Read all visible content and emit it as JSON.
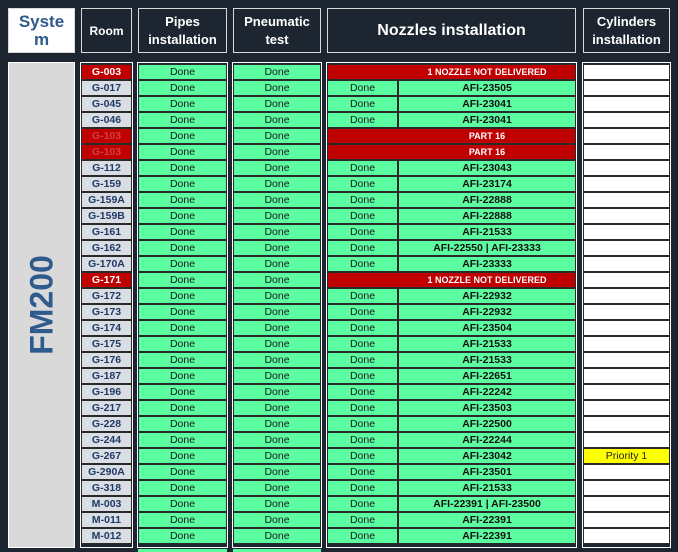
{
  "headers": {
    "system": [
      "Syste",
      "m"
    ],
    "room": "Room",
    "pipes": [
      "Pipes",
      "installation"
    ],
    "pneumatic": [
      "Pneumatic",
      "test"
    ],
    "nozzles": "Nozzles installation",
    "cylinders": [
      "Cylinders",
      "installation"
    ]
  },
  "system_label": "FM200",
  "rows": [
    {
      "room": "G-003",
      "room_status": "red",
      "pipes": "Done",
      "pneumatic": "Done",
      "nozzle_done": "",
      "nozzle": "1 NOZZLE NOT DELIVERED",
      "nozzle_status": "red",
      "cylinder": ""
    },
    {
      "room": "G-017",
      "room_status": "normal",
      "pipes": "Done",
      "pneumatic": "Done",
      "nozzle_done": "Done",
      "nozzle": "AFI-23505",
      "nozzle_status": "ok",
      "cylinder": ""
    },
    {
      "room": "G-045",
      "room_status": "normal",
      "pipes": "Done",
      "pneumatic": "Done",
      "nozzle_done": "Done",
      "nozzle": "AFI-23041",
      "nozzle_status": "ok",
      "cylinder": ""
    },
    {
      "room": "G-046",
      "room_status": "normal",
      "pipes": "Done",
      "pneumatic": "Done",
      "nozzle_done": "Done",
      "nozzle": "AFI-23041",
      "nozzle_status": "ok",
      "cylinder": ""
    },
    {
      "room": "G-103",
      "room_status": "red-dim",
      "pipes": "Done",
      "pneumatic": "Done",
      "nozzle_done": "",
      "nozzle": "PART 16",
      "nozzle_status": "red",
      "cylinder": ""
    },
    {
      "room": "G-103",
      "room_status": "red-dim",
      "pipes": "Done",
      "pneumatic": "Done",
      "nozzle_done": "",
      "nozzle": "PART 16",
      "nozzle_status": "red",
      "cylinder": ""
    },
    {
      "room": "G-112",
      "room_status": "normal",
      "pipes": "Done",
      "pneumatic": "Done",
      "nozzle_done": "Done",
      "nozzle": "AFI-23043",
      "nozzle_status": "ok",
      "cylinder": ""
    },
    {
      "room": "G-159",
      "room_status": "normal",
      "pipes": "Done",
      "pneumatic": "Done",
      "nozzle_done": "Done",
      "nozzle": "AFI-23174",
      "nozzle_status": "ok",
      "cylinder": ""
    },
    {
      "room": "G-159A",
      "room_status": "normal",
      "pipes": "Done",
      "pneumatic": "Done",
      "nozzle_done": "Done",
      "nozzle": "AFI-22888",
      "nozzle_status": "ok",
      "cylinder": ""
    },
    {
      "room": "G-159B",
      "room_status": "normal",
      "pipes": "Done",
      "pneumatic": "Done",
      "nozzle_done": "Done",
      "nozzle": "AFI-22888",
      "nozzle_status": "ok",
      "cylinder": ""
    },
    {
      "room": "G-161",
      "room_status": "normal",
      "pipes": "Done",
      "pneumatic": "Done",
      "nozzle_done": "Done",
      "nozzle": "AFI-21533",
      "nozzle_status": "ok",
      "cylinder": ""
    },
    {
      "room": "G-162",
      "room_status": "normal",
      "pipes": "Done",
      "pneumatic": "Done",
      "nozzle_done": "Done",
      "nozzle": "AFI-22550  |  AFI-23333",
      "nozzle_status": "ok",
      "cylinder": ""
    },
    {
      "room": "G-170A",
      "room_status": "normal",
      "pipes": "Done",
      "pneumatic": "Done",
      "nozzle_done": "Done",
      "nozzle": "AFI-23333",
      "nozzle_status": "ok",
      "cylinder": ""
    },
    {
      "room": "G-171",
      "room_status": "red",
      "pipes": "Done",
      "pneumatic": "Done",
      "nozzle_done": "",
      "nozzle": "1 NOZZLE NOT DELIVERED",
      "nozzle_status": "red",
      "cylinder": ""
    },
    {
      "room": "G-172",
      "room_status": "normal",
      "pipes": "Done",
      "pneumatic": "Done",
      "nozzle_done": "Done",
      "nozzle": "AFI-22932",
      "nozzle_status": "ok",
      "cylinder": ""
    },
    {
      "room": "G-173",
      "room_status": "normal",
      "pipes": "Done",
      "pneumatic": "Done",
      "nozzle_done": "Done",
      "nozzle": "AFI-22932",
      "nozzle_status": "ok",
      "cylinder": ""
    },
    {
      "room": "G-174",
      "room_status": "normal",
      "pipes": "Done",
      "pneumatic": "Done",
      "nozzle_done": "Done",
      "nozzle": "AFI-23504",
      "nozzle_status": "ok",
      "cylinder": ""
    },
    {
      "room": "G-175",
      "room_status": "normal",
      "pipes": "Done",
      "pneumatic": "Done",
      "nozzle_done": "Done",
      "nozzle": "AFI-21533",
      "nozzle_status": "ok",
      "cylinder": ""
    },
    {
      "room": "G-176",
      "room_status": "normal",
      "pipes": "Done",
      "pneumatic": "Done",
      "nozzle_done": "Done",
      "nozzle": "AFI-21533",
      "nozzle_status": "ok",
      "cylinder": ""
    },
    {
      "room": "G-187",
      "room_status": "normal",
      "pipes": "Done",
      "pneumatic": "Done",
      "nozzle_done": "Done",
      "nozzle": "AFI-22651",
      "nozzle_status": "ok",
      "cylinder": ""
    },
    {
      "room": "G-196",
      "room_status": "normal",
      "pipes": "Done",
      "pneumatic": "Done",
      "nozzle_done": "Done",
      "nozzle": "AFI-22242",
      "nozzle_status": "ok",
      "cylinder": ""
    },
    {
      "room": "G-217",
      "room_status": "normal",
      "pipes": "Done",
      "pneumatic": "Done",
      "nozzle_done": "Done",
      "nozzle": "AFI-23503",
      "nozzle_status": "ok",
      "cylinder": ""
    },
    {
      "room": "G-228",
      "room_status": "normal",
      "pipes": "Done",
      "pneumatic": "Done",
      "nozzle_done": "Done",
      "nozzle": "AFI-22500",
      "nozzle_status": "ok",
      "cylinder": ""
    },
    {
      "room": "G-244",
      "room_status": "normal",
      "pipes": "Done",
      "pneumatic": "Done",
      "nozzle_done": "Done",
      "nozzle": "AFI-22244",
      "nozzle_status": "ok",
      "cylinder": ""
    },
    {
      "room": "G-267",
      "room_status": "normal",
      "pipes": "Done",
      "pneumatic": "Done",
      "nozzle_done": "Done",
      "nozzle": "AFI-23042",
      "nozzle_status": "ok",
      "cylinder": "Priority 1"
    },
    {
      "room": "G-290A",
      "room_status": "normal",
      "pipes": "Done",
      "pneumatic": "Done",
      "nozzle_done": "Done",
      "nozzle": "AFI-23501",
      "nozzle_status": "ok",
      "cylinder": ""
    },
    {
      "room": "G-318",
      "room_status": "normal",
      "pipes": "Done",
      "pneumatic": "Done",
      "nozzle_done": "Done",
      "nozzle": "AFI-21533",
      "nozzle_status": "ok",
      "cylinder": ""
    },
    {
      "room": "M-003",
      "room_status": "normal",
      "pipes": "Done",
      "pneumatic": "Done",
      "nozzle_done": "Done",
      "nozzle": "AFI-22391  | AFI-23500",
      "nozzle_status": "ok",
      "cylinder": ""
    },
    {
      "room": "M-011",
      "room_status": "normal",
      "pipes": "Done",
      "pneumatic": "Done",
      "nozzle_done": "Done",
      "nozzle": "AFI-22391",
      "nozzle_status": "ok",
      "cylinder": ""
    },
    {
      "room": "M-012",
      "room_status": "normal",
      "pipes": "Done",
      "pneumatic": "Done",
      "nozzle_done": "Done",
      "nozzle": "AFI-22391",
      "nozzle_status": "ok",
      "cylinder": ""
    }
  ],
  "colors": {
    "background": "#1c2530",
    "done_green": "#5cfca0",
    "alert_red": "#c00000",
    "priority_yellow": "#ffff00",
    "system_blue": "#2e5a8c"
  }
}
